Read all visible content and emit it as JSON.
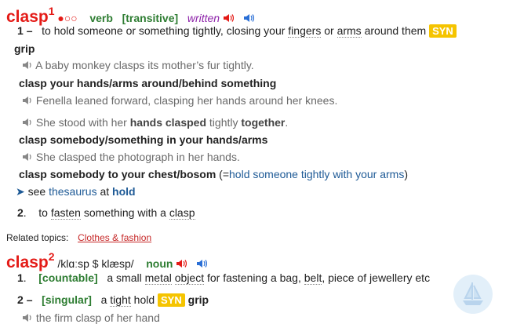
{
  "entry1": {
    "headword": "clasp",
    "homnum": "1",
    "frequency": "●○○",
    "pos": "verb",
    "grammar": "[transitive]",
    "register": "written"
  },
  "sense1": {
    "num": "1",
    "def_pre": "to hold someone or something tightly, closing your",
    "def_link1": "fingers",
    "def_mid": "or",
    "def_link2": "arms",
    "def_post": "around them",
    "syn_badge": "SYN",
    "syn_word": "grip",
    "ex1": "A baby monkey clasps its mother’s fur tightly.",
    "colloc1": "clasp your hands/arms around/behind something",
    "ex2": "Fenella leaned forward, clasping her hands around her knees.",
    "ex3_pre": "She stood with her",
    "ex3_b1": "hands clasped",
    "ex3_mid": "tightly",
    "ex3_b2": "together",
    "ex3_post": ".",
    "colloc2": "clasp somebody/something in your hands/arms",
    "ex4": "She clasped the photograph in her hands.",
    "colloc3": "clasp somebody to your chest/bosom",
    "colloc3_gloss_pre": "(=",
    "colloc3_gloss": "hold someone tightly with your arms",
    "colloc3_gloss_post": ")",
    "see_label": "see",
    "see_link": "thesaurus",
    "see_at": "at",
    "see_target": "hold"
  },
  "sense2": {
    "num": "2",
    "def_pre": "to",
    "def_link": "fasten",
    "def_mid": "something with a",
    "def_link2": "clasp"
  },
  "related": {
    "label": "Related topics:",
    "topic": "Clothes & fashion"
  },
  "entry2": {
    "headword": "clasp",
    "homnum": "2",
    "pron": "/klɑːsp $ klæsp/",
    "pos": "noun"
  },
  "noun_sense1": {
    "num": "1",
    "grammar": "[countable]",
    "def_pre": "a small",
    "def_link1": "metal",
    "def_link2": "object",
    "def_mid": "for fastening a bag,",
    "def_link3": "belt",
    "def_post": ", piece of jewellery etc"
  },
  "noun_sense2": {
    "num": "2",
    "grammar": "[singular]",
    "def_pre": "a",
    "def_link1": "tight",
    "def_link2": "hold",
    "syn_badge": "SYN",
    "syn_word": "grip",
    "ex1": "the firm clasp of her hand"
  },
  "colors": {
    "headword": "#e41b17",
    "grammar": "#2e7d32",
    "register": "#8e24aa",
    "syn": "#f5c400",
    "link": "#1e5a96"
  }
}
